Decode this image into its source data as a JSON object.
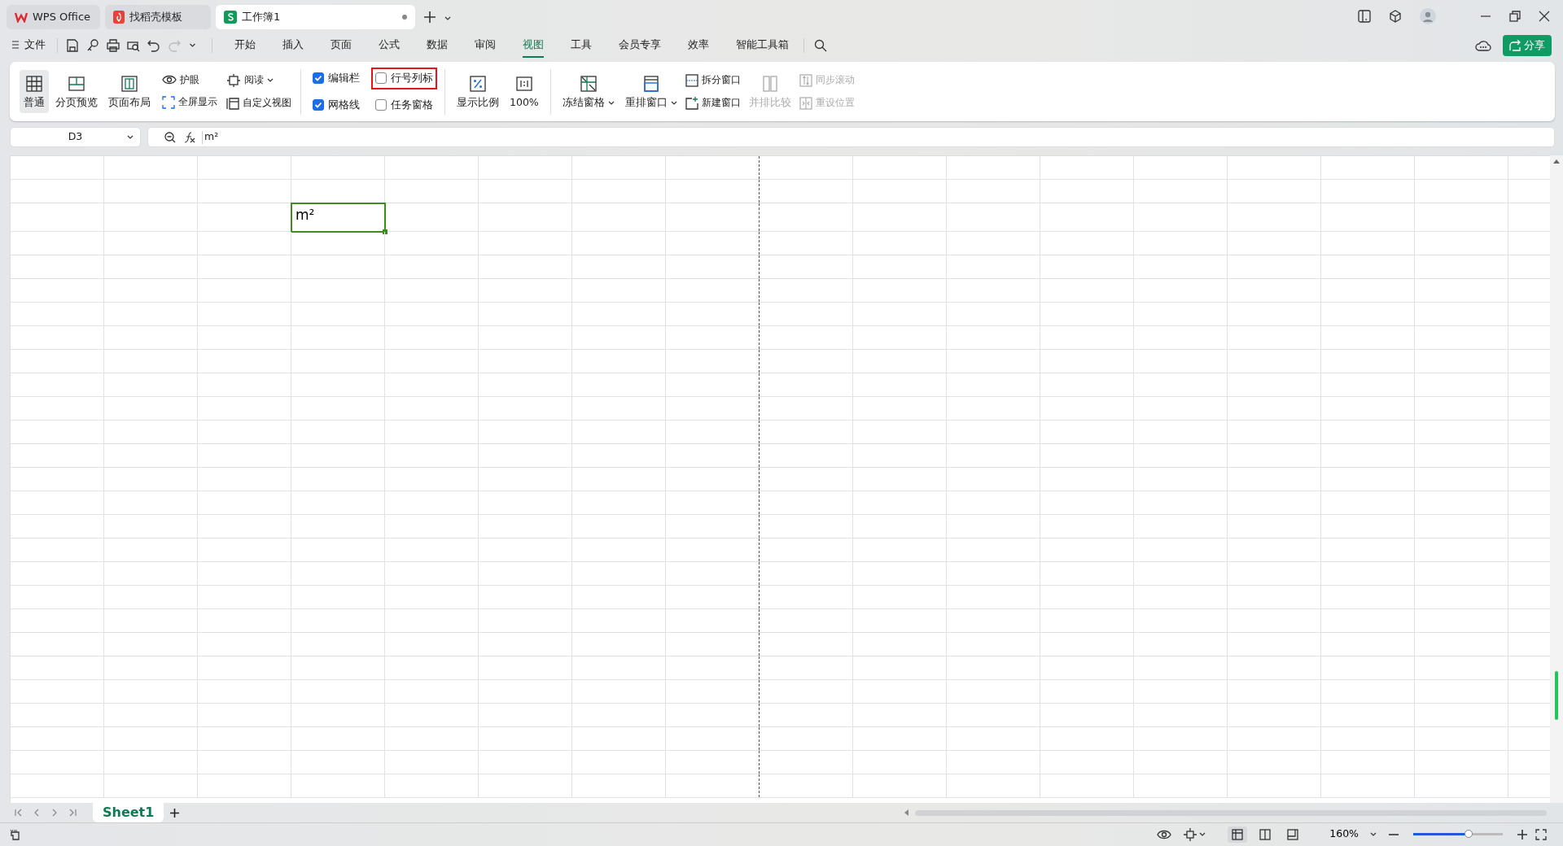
{
  "window_tabs": [
    {
      "label": "WPS Office",
      "kind": "wps",
      "selected": false
    },
    {
      "label": "找稻壳模板",
      "kind": "template",
      "selected": false
    },
    {
      "label": "工作簿1",
      "kind": "sheet",
      "selected": true
    }
  ],
  "menu": {
    "file": "文件",
    "tabs": [
      {
        "label": "开始",
        "selected": false
      },
      {
        "label": "插入",
        "selected": false
      },
      {
        "label": "页面",
        "selected": false
      },
      {
        "label": "公式",
        "selected": false
      },
      {
        "label": "数据",
        "selected": false
      },
      {
        "label": "审阅",
        "selected": false
      },
      {
        "label": "视图",
        "selected": true
      },
      {
        "label": "工具",
        "selected": false
      },
      {
        "label": "会员专享",
        "selected": false
      },
      {
        "label": "效率",
        "selected": false
      },
      {
        "label": "智能工具箱",
        "selected": false
      }
    ],
    "share": "分享"
  },
  "ribbon": {
    "views": [
      {
        "label": "普通",
        "selected": true
      },
      {
        "label": "分页预览",
        "selected": false
      },
      {
        "label": "页面布局",
        "selected": false
      }
    ],
    "small": [
      {
        "label": "护眼",
        "dropdown": false
      },
      {
        "label": "阅读",
        "dropdown": true
      },
      {
        "label": "全屏显示",
        "dropdown": false
      },
      {
        "label": "自定义视图",
        "dropdown": false
      }
    ],
    "checkboxes": [
      {
        "label": "编辑栏",
        "checked": true,
        "highlighted": false
      },
      {
        "label": "网格线",
        "checked": true,
        "highlighted": false
      },
      {
        "label": "行号列标",
        "checked": false,
        "highlighted": true
      },
      {
        "label": "任务窗格",
        "checked": false,
        "highlighted": false
      }
    ],
    "zoom": [
      {
        "label": "显示比例"
      },
      {
        "label": "100%"
      }
    ],
    "windows": [
      {
        "label": "冻结窗格",
        "dropdown": true
      },
      {
        "label": "重排窗口",
        "dropdown": true
      }
    ],
    "window_small": [
      {
        "label": "拆分窗口",
        "disabled": false
      },
      {
        "label": "新建窗口",
        "disabled": false
      }
    ],
    "compare": {
      "label": "并排比较",
      "disabled": true
    },
    "sync": [
      {
        "label": "同步滚动",
        "disabled": true
      },
      {
        "label": "重设位置",
        "disabled": true
      }
    ]
  },
  "formula_bar": {
    "name_box": "D3",
    "formula": "m²"
  },
  "sheet": {
    "active_cell": "m²"
  },
  "sheet_tabs": [
    {
      "label": "Sheet1",
      "selected": true
    }
  ],
  "status_bar": {
    "views": [
      {
        "selected": true
      },
      {
        "selected": false
      },
      {
        "selected": false
      }
    ],
    "zoom": "160%",
    "zoom_slider": {
      "level": 0.62
    }
  }
}
